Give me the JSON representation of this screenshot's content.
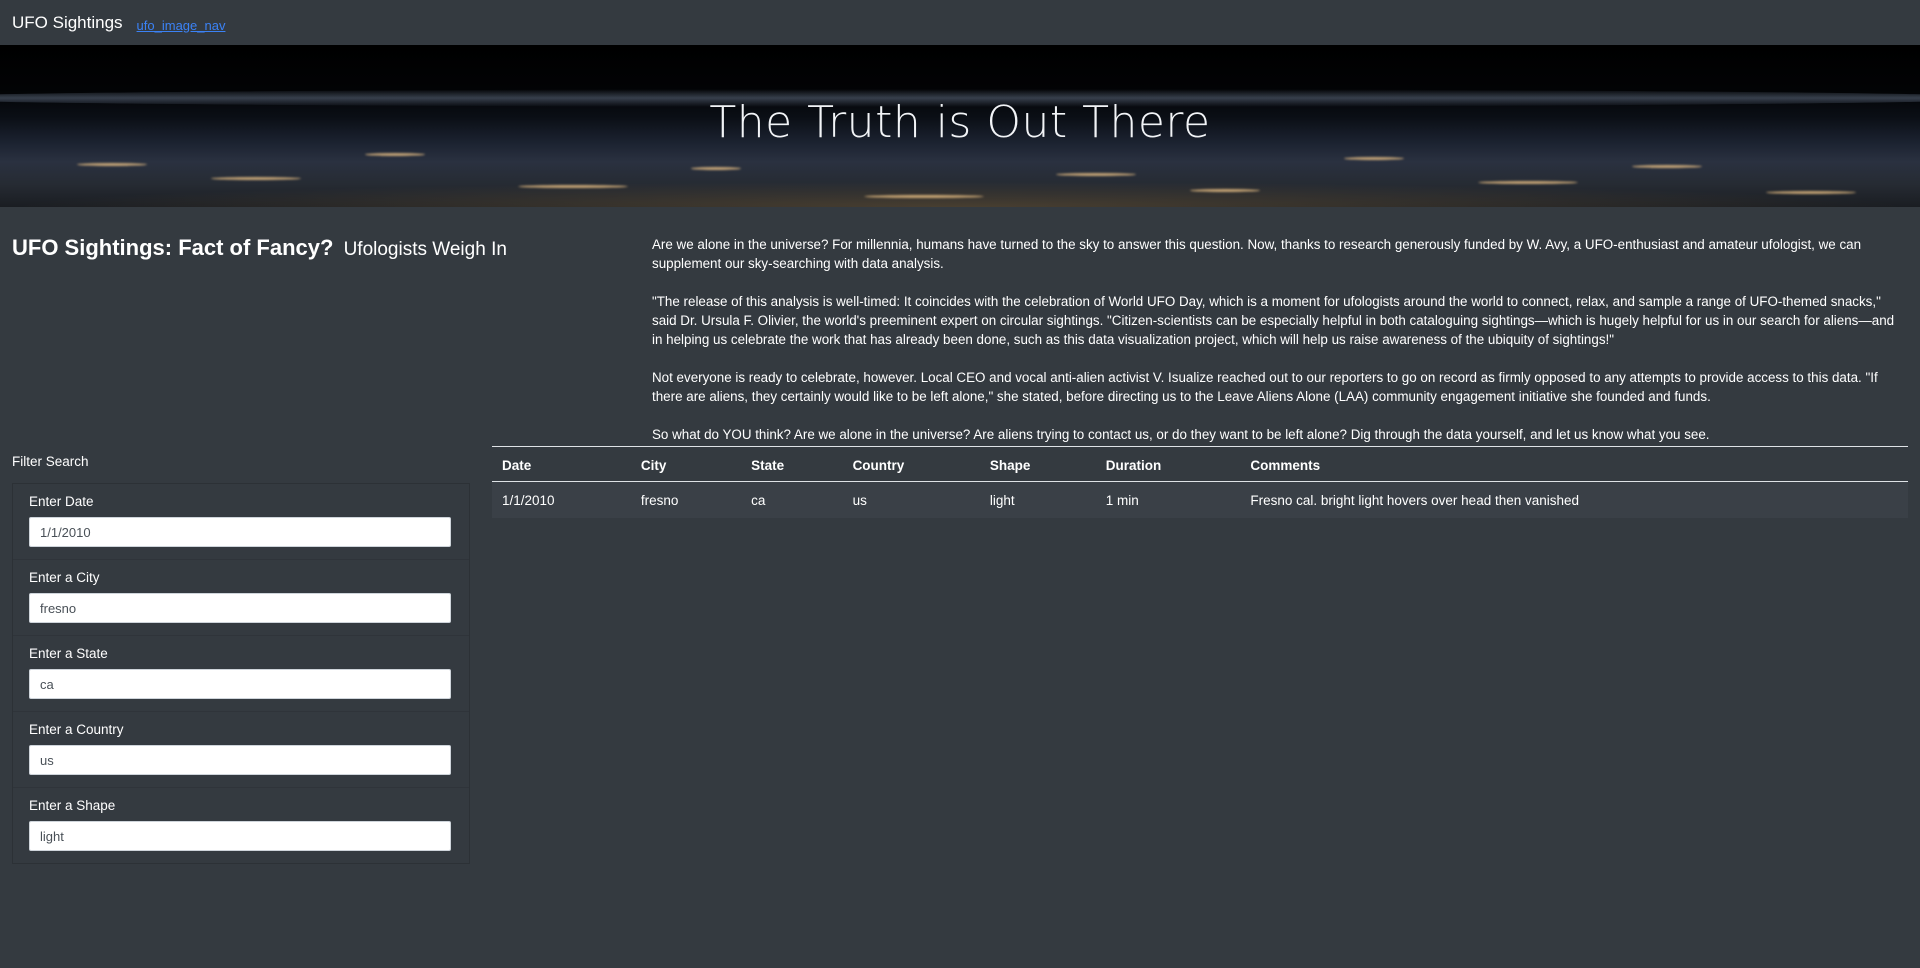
{
  "navbar": {
    "brand": "UFO Sightings",
    "image_alt": "ufo_image_nav"
  },
  "hero": {
    "title": "The Truth is Out There"
  },
  "intro": {
    "heading": "UFO Sightings: Fact of Fancy?",
    "subheading": "Ufologists Weigh In",
    "paragraphs": [
      "Are we alone in the universe? For millennia, humans have turned to the sky to answer this question. Now, thanks to research generously funded by W. Avy, a UFO-enthusiast and amateur ufologist, we can supplement our sky-searching with data analysis.",
      "\"The release of this analysis is well-timed: It coincides with the celebration of World UFO Day, which is a moment for ufologists around the world to connect, relax, and sample a range of UFO-themed snacks,\" said Dr. Ursula F. Olivier, the world's preeminent expert on circular sightings. \"Citizen-scientists can be especially helpful in both cataloguing sightings—which is hugely helpful for us in our search for aliens—and in helping us celebrate the work that has already been done, such as this data visualization project, which will help us raise awareness of the ubiquity of sightings!\"",
      "Not everyone is ready to celebrate, however. Local CEO and vocal anti-alien activist V. Isualize reached out to our reporters to go on record as firmly opposed to any attempts to provide access to this data. \"If there are aliens, they certainly would like to be left alone,\" she stated, before directing us to the Leave Aliens Alone (LAA) community engagement initiative she founded and funds.",
      "So what do YOU think? Are we alone in the universe? Are aliens trying to contact us, or do they want to be left alone? Dig through the data yourself, and let us know what you see."
    ]
  },
  "filters": {
    "title": "Filter Search",
    "items": [
      {
        "label": "Enter Date",
        "value": "1/1/2010"
      },
      {
        "label": "Enter a City",
        "value": "fresno"
      },
      {
        "label": "Enter a State",
        "value": "ca"
      },
      {
        "label": "Enter a Country",
        "value": "us"
      },
      {
        "label": "Enter a Shape",
        "value": "light"
      }
    ]
  },
  "table": {
    "headers": [
      "Date",
      "City",
      "State",
      "Country",
      "Shape",
      "Duration",
      "Comments"
    ],
    "rows": [
      [
        "1/1/2010",
        "fresno",
        "ca",
        "us",
        "light",
        "1 min",
        "Fresno cal. bright light hovers over head then vanished"
      ]
    ]
  }
}
